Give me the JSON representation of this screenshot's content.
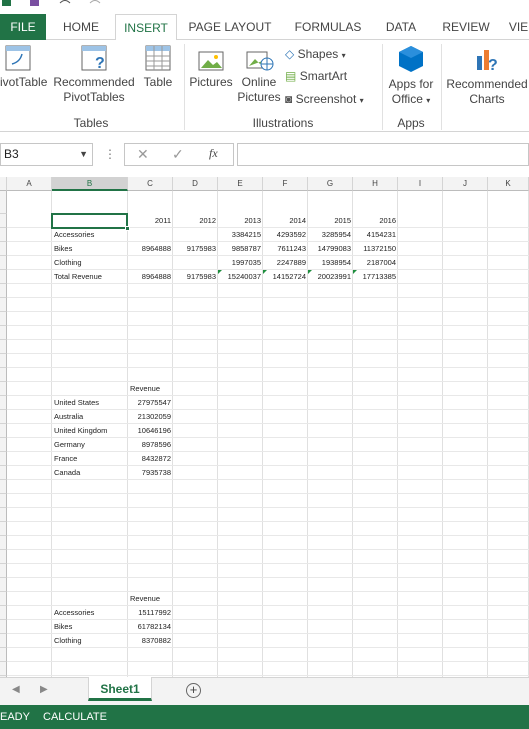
{
  "ribbon_tabs": [
    "FILE",
    "HOME",
    "INSERT",
    "PAGE LAYOUT",
    "FORMULAS",
    "DATA",
    "REVIEW",
    "VIE"
  ],
  "active_tab": "INSERT",
  "ribbon": {
    "pivottable": "ivotTable",
    "recommended_pivot_1": "Recommended",
    "recommended_pivot_2": "PivotTables",
    "table": "Table",
    "pictures": "Pictures",
    "online_pictures_1": "Online",
    "online_pictures_2": "Pictures",
    "shapes": "Shapes",
    "smartart": "SmartArt",
    "screenshot": "Screenshot",
    "apps_1": "Apps for",
    "apps_2": "Office",
    "rec_charts_1": "Recommended",
    "rec_charts_2": "Charts",
    "groups": {
      "tables": "Tables",
      "illustrations": "Illustrations",
      "apps": "Apps"
    }
  },
  "formula_bar": {
    "name_box": "B3",
    "fx": "fx",
    "value": ""
  },
  "columns": [
    "A",
    "B",
    "C",
    "D",
    "E",
    "F",
    "G",
    "H",
    "I",
    "J",
    "K"
  ],
  "selected_column": "B",
  "table1": {
    "years": [
      "2011",
      "2012",
      "2013",
      "2014",
      "2015",
      "2016"
    ],
    "rows": [
      {
        "label": "Accessories",
        "values": [
          "",
          "",
          "3384215",
          "4293592",
          "3285954",
          "4154231"
        ]
      },
      {
        "label": "Bikes",
        "values": [
          "8964888",
          "9175983",
          "9858787",
          "7611243",
          "14799083",
          "11372150"
        ]
      },
      {
        "label": "Clothing",
        "values": [
          "",
          "",
          "1997035",
          "2247889",
          "1938954",
          "2187004"
        ]
      },
      {
        "label": "Total Revenue",
        "values": [
          "8964888",
          "9175983",
          "15240037",
          "14152724",
          "20023991",
          "17713385"
        ]
      }
    ]
  },
  "table2": {
    "header": "Revenue",
    "rows": [
      {
        "label": "United States",
        "value": "27975547"
      },
      {
        "label": "Australia",
        "value": "21302059"
      },
      {
        "label": "United Kingdom",
        "value": "10646196"
      },
      {
        "label": "Germany",
        "value": "8978596"
      },
      {
        "label": "France",
        "value": "8432872"
      },
      {
        "label": "Canada",
        "value": "7935738"
      }
    ]
  },
  "table3": {
    "header": "Revenue",
    "rows": [
      {
        "label": "Accessories",
        "value": "15117992"
      },
      {
        "label": "Bikes",
        "value": "61782134"
      },
      {
        "label": "Clothing",
        "value": "8370882"
      }
    ]
  },
  "sheet_tab": "Sheet1",
  "status": {
    "ready": "EADY",
    "calculate": "CALCULATE"
  },
  "colors": {
    "excel_green": "#217346",
    "error_marker": "#1e8e3e"
  }
}
